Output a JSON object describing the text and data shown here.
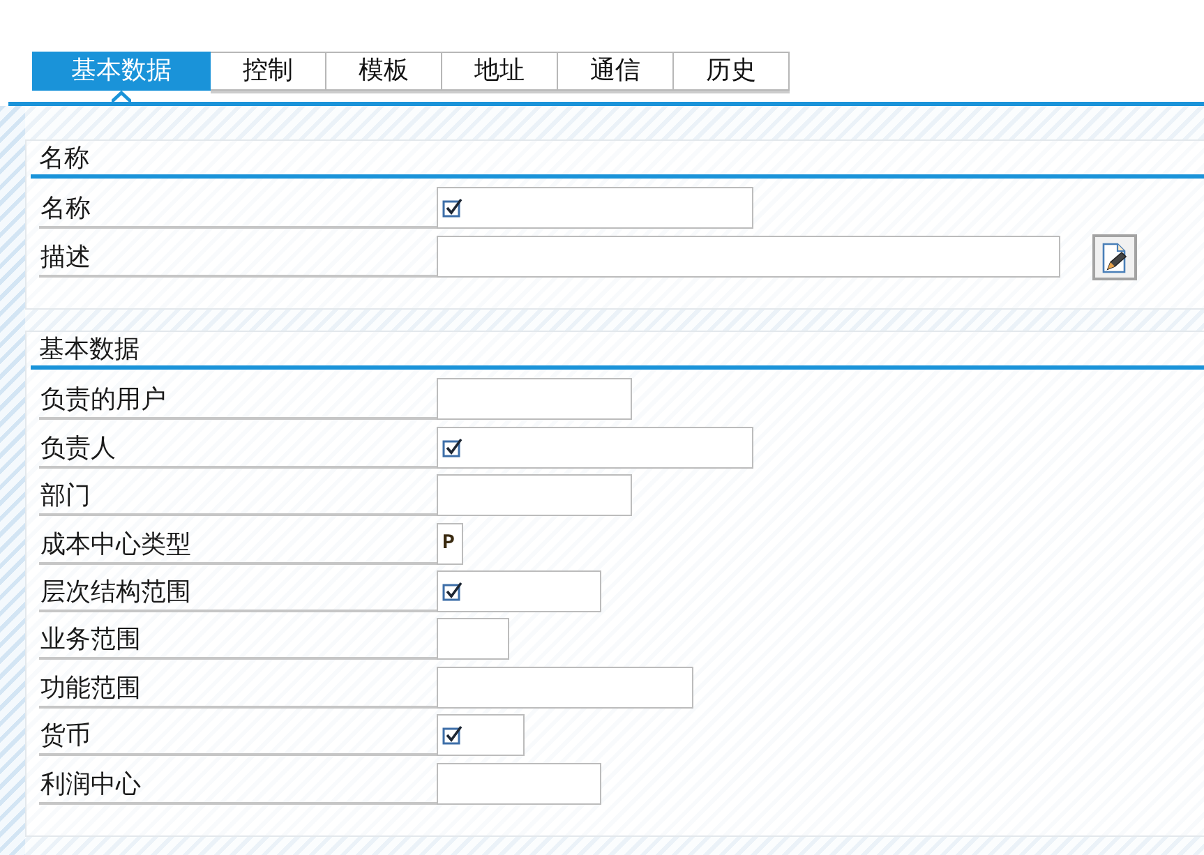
{
  "tabs": [
    {
      "label": "基本数据",
      "selected": true
    },
    {
      "label": "控制",
      "selected": false
    },
    {
      "label": "模板",
      "selected": false
    },
    {
      "label": "地址",
      "selected": false
    },
    {
      "label": "通信",
      "selected": false
    },
    {
      "label": "历史",
      "selected": false
    }
  ],
  "sections": [
    {
      "title": "名称",
      "fields": [
        {
          "label": "名称",
          "required": true,
          "edit_button": false
        },
        {
          "label": "描述",
          "required": false,
          "edit_button": true
        }
      ]
    },
    {
      "title": "基本数据",
      "fields": [
        {
          "label": "负责的用户",
          "required": false,
          "edit_button": false
        },
        {
          "label": "负责人",
          "required": true,
          "edit_button": false
        },
        {
          "label": "部门",
          "required": false,
          "edit_button": false
        },
        {
          "label": "成本中心类型",
          "required": false,
          "edit_button": false,
          "value": "P"
        },
        {
          "label": "层次结构范围",
          "required": true,
          "edit_button": false
        },
        {
          "label": "业务范围",
          "required": false,
          "edit_button": false
        },
        {
          "label": "功能范围",
          "required": false,
          "edit_button": false
        },
        {
          "label": "货币",
          "required": true,
          "edit_button": false
        },
        {
          "label": "利润中心",
          "required": false,
          "edit_button": false
        }
      ]
    }
  ]
}
